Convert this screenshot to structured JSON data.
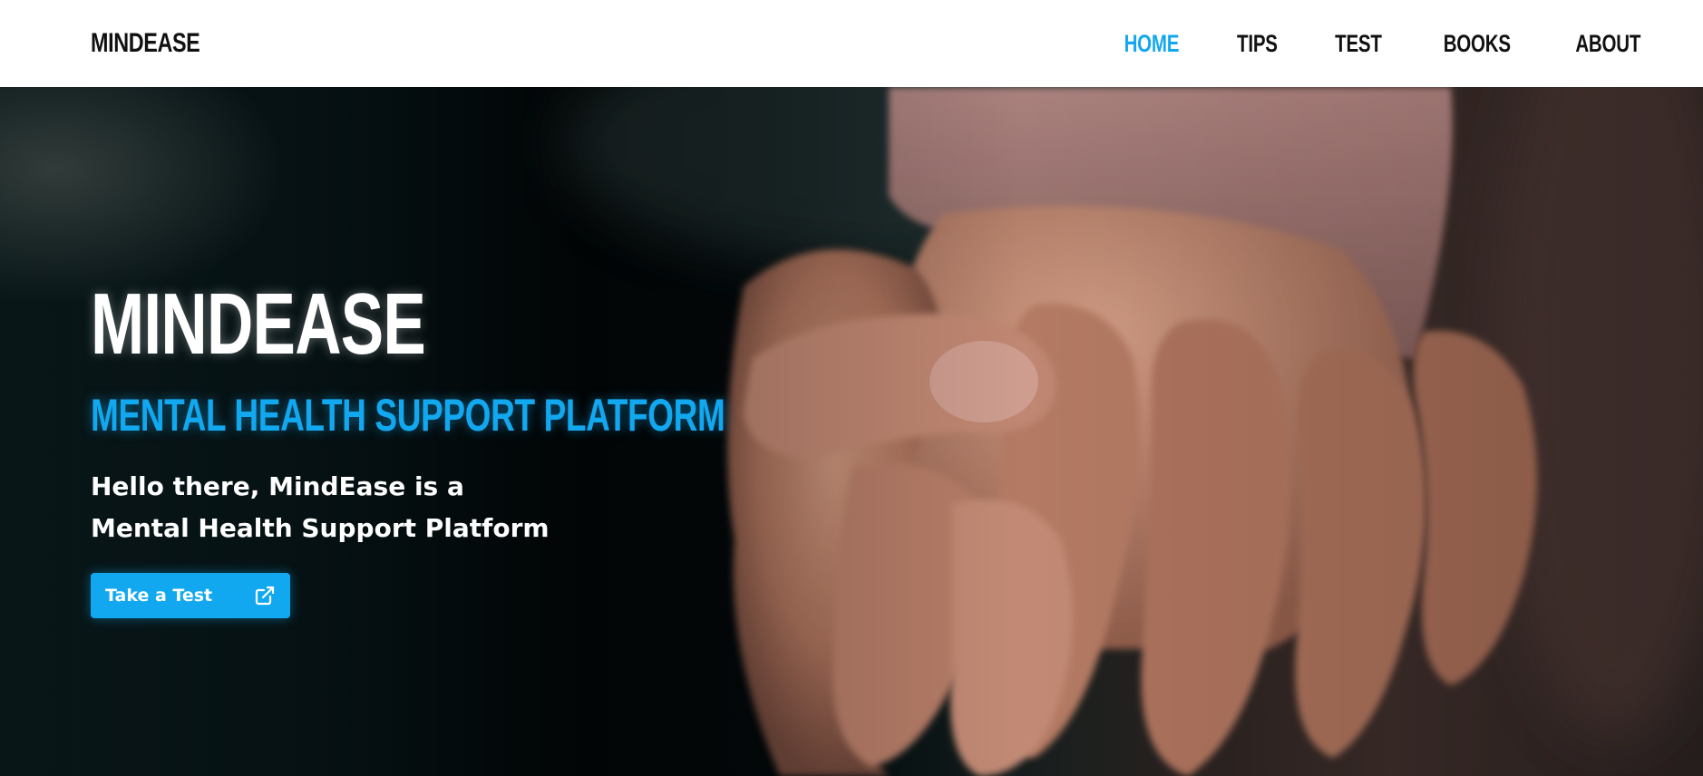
{
  "navbar": {
    "brand": "MINDEASE",
    "links": [
      {
        "label": "HOME",
        "active": true
      },
      {
        "label": "TIPS",
        "active": false
      },
      {
        "label": "TEST",
        "active": false
      },
      {
        "label": "BOOKS",
        "active": false
      },
      {
        "label": "ABOUT",
        "active": false
      }
    ]
  },
  "hero": {
    "title": "MINDEASE",
    "subtitle": "MENTAL HEALTH SUPPORT PLATFORM",
    "description_line1": "Hello there, MindEase is a",
    "description_line2": "Mental Health Support Platform",
    "cta_label": "Take a Test",
    "cta_icon": "external-link-icon",
    "background_image": "hands-holding-photo"
  },
  "colors": {
    "accent": "#12a8f0",
    "nav_text": "#111111",
    "navbar_bg": "#ffffff",
    "hero_text": "#ffffff"
  }
}
